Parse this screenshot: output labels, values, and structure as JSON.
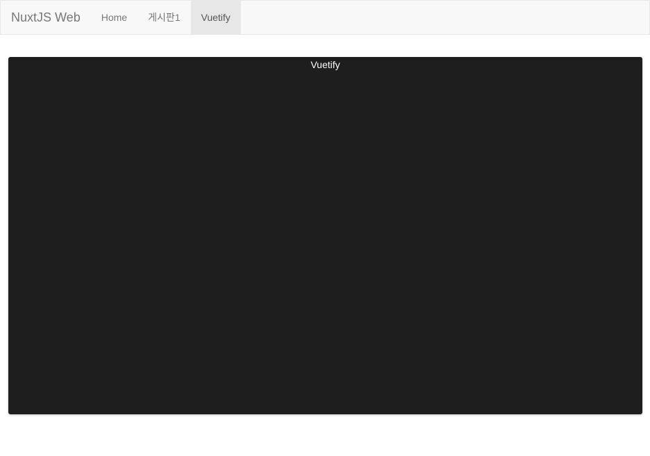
{
  "navbar": {
    "brand": "NuxtJS Web",
    "items": [
      {
        "label": "Home",
        "active": false
      },
      {
        "label": "게시판1",
        "active": false
      },
      {
        "label": "Vuetify",
        "active": true
      }
    ]
  },
  "main": {
    "card_title": "Vuetify"
  },
  "colors": {
    "navbar_bg": "#f8f8f8",
    "active_item_bg": "#e7e7e7",
    "card_bg": "#1e1e1e"
  }
}
